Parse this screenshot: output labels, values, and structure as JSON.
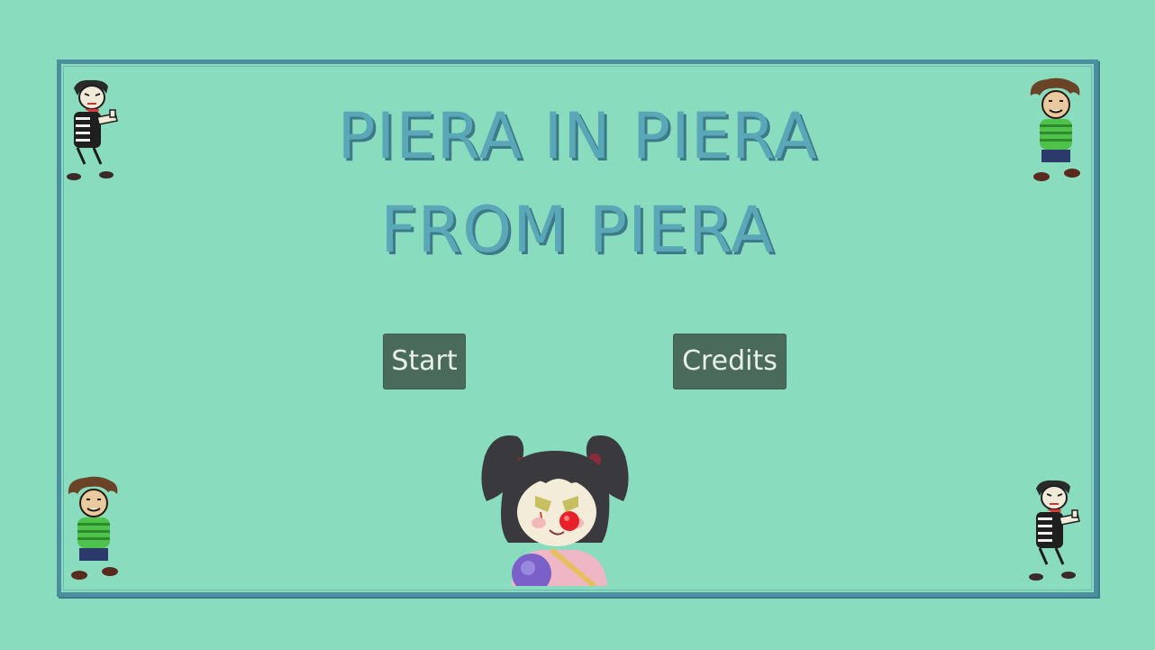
{
  "game": {
    "title_line_1": "PIERA IN PIERA",
    "title_line_2": "FROM PIERA"
  },
  "menu": {
    "start_label": "Start",
    "credits_label": "Credits"
  },
  "colors": {
    "background": "#8adcbf",
    "frame": "#4a8f9f",
    "title": "#5aa7b7",
    "button_bg": "#4a6b5c",
    "button_text": "#e8efe9"
  },
  "sprites": {
    "top_left": "mime-character",
    "top_right": "boy-green-sweater-character",
    "bottom_left": "boy-green-sweater-character",
    "bottom_right": "mime-character",
    "center_bottom": "clown-girl-character"
  }
}
